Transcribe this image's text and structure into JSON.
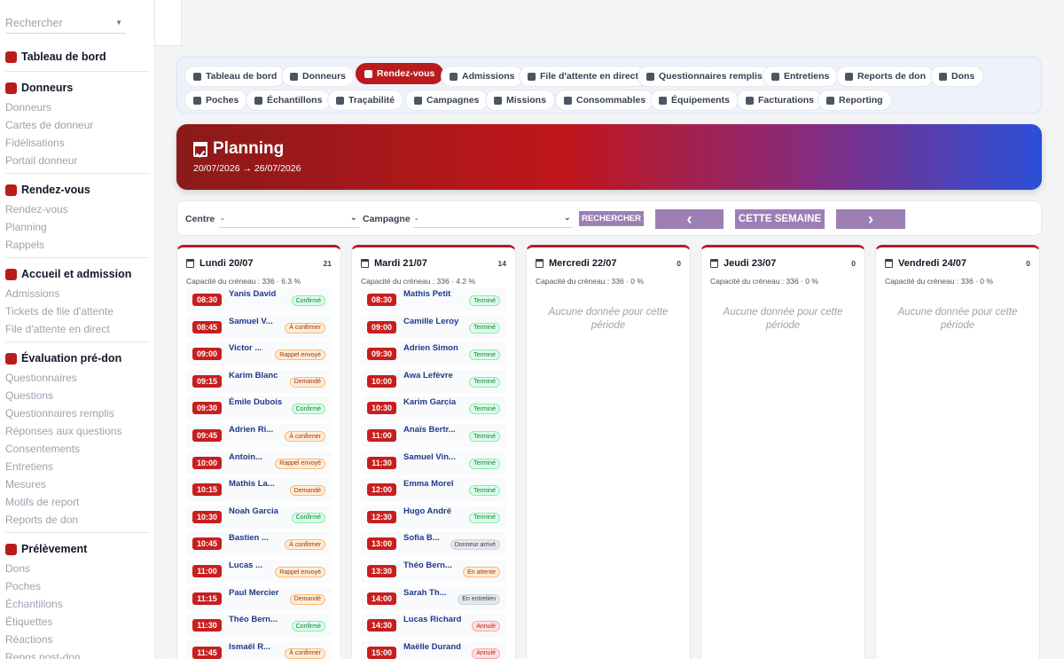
{
  "sidebar": {
    "search_placeholder": "Rechercher",
    "sections": [
      {
        "title": "Tableau de bord",
        "icon": "dashboard-icon",
        "items": []
      },
      {
        "title": "Donneurs",
        "icon": "user-plus-icon",
        "items": [
          "Donneurs",
          "Cartes de donneur",
          "Fidélisations",
          "Portail donneur"
        ]
      },
      {
        "title": "Rendez-vous",
        "icon": "calendar-icon",
        "items": [
          "Rendez-vous",
          "Planning",
          "Rappels"
        ]
      },
      {
        "title": "Accueil et admission",
        "icon": "clipboard-check-icon",
        "items": [
          "Admissions",
          "Tickets de file d'attente",
          "File d'attente en direct"
        ]
      },
      {
        "title": "Évaluation pré-don",
        "icon": "stethoscope-icon",
        "items": [
          "Questionnaires",
          "Questions",
          "Questionnaires remplis",
          "Réponses aux questions",
          "Consentements",
          "Entretiens",
          "Mesures",
          "Motifs de report",
          "Reports de don"
        ]
      },
      {
        "title": "Prélèvement",
        "icon": "blood-drop-icon",
        "items": [
          "Dons",
          "Poches",
          "Échantillons",
          "Étiquettes",
          "Réactions",
          "Repos post-don"
        ]
      }
    ]
  },
  "tabs": [
    {
      "label": "Tableau de bord",
      "icon": "dashboard-icon"
    },
    {
      "label": "Donneurs",
      "icon": "user-plus-icon"
    },
    {
      "label": "Rendez-vous",
      "icon": "calendar-icon",
      "active": true
    },
    {
      "label": "Admissions",
      "icon": "clipboard-icon"
    },
    {
      "label": "File d'attente en direct",
      "icon": "hourglass-icon"
    },
    {
      "label": "Questionnaires remplis",
      "icon": "list-check-icon"
    },
    {
      "label": "Entretiens",
      "icon": "stethoscope-icon"
    },
    {
      "label": "Reports de don",
      "icon": "calendar-x-icon"
    },
    {
      "label": "Dons",
      "icon": "blood-drop-icon"
    },
    {
      "label": "Poches",
      "icon": "bag-icon"
    },
    {
      "label": "Échantillons",
      "icon": "vial-icon"
    },
    {
      "label": "Traçabilité",
      "icon": "network-icon"
    },
    {
      "label": "Campagnes",
      "icon": "megaphone-icon"
    },
    {
      "label": "Missions",
      "icon": "route-icon"
    },
    {
      "label": "Consommables",
      "icon": "boxes-icon"
    },
    {
      "label": "Équipements",
      "icon": "desktop-icon"
    },
    {
      "label": "Facturations",
      "icon": "invoice-icon"
    },
    {
      "label": "Reporting",
      "icon": "chart-pie-icon"
    }
  ],
  "hero": {
    "title": "Planning",
    "range": "20/07/2026 → 26/07/2026",
    "icon": "calendar-check-icon"
  },
  "filters": {
    "centre_label": "Centre",
    "centre_value": "-",
    "campagne_label": "Campagne",
    "campagne_value": "-",
    "search_label": "RECHERCHER",
    "prev_label": "‹",
    "week_label": "CETTE SEMAINE",
    "next_label": "›"
  },
  "colors": {
    "accent": "#b91c1c",
    "button": "#9d7fb5",
    "name": "#1e3a8a"
  },
  "days": [
    {
      "title": "Lundi 20/07",
      "count": "21",
      "capacity": "Capacité du créneau : 336 · 6.3 %",
      "slots": [
        {
          "time": "08:30",
          "name": "Yanis David",
          "status": "Confirmé",
          "tone": "green"
        },
        {
          "time": "08:45",
          "name": "Samuel V...",
          "status": "À confirmer",
          "tone": "orange"
        },
        {
          "time": "09:00",
          "name": "Victor ...",
          "status": "Rappel envoyé",
          "tone": "orange"
        },
        {
          "time": "09:15",
          "name": "Karim Blanc",
          "status": "Demandé",
          "tone": "orange"
        },
        {
          "time": "09:30",
          "name": "Émile Dubois",
          "status": "Confirmé",
          "tone": "green"
        },
        {
          "time": "09:45",
          "name": "Adrien Ri...",
          "status": "À confirmer",
          "tone": "orange"
        },
        {
          "time": "10:00",
          "name": "Antoin...",
          "status": "Rappel envoyé",
          "tone": "orange"
        },
        {
          "time": "10:15",
          "name": "Mathis La...",
          "status": "Demandé",
          "tone": "orange"
        },
        {
          "time": "10:30",
          "name": "Noah Garcia",
          "status": "Confirmé",
          "tone": "green"
        },
        {
          "time": "10:45",
          "name": "Bastien ...",
          "status": "À confirmer",
          "tone": "orange"
        },
        {
          "time": "11:00",
          "name": "Lucas ...",
          "status": "Rappel envoyé",
          "tone": "orange"
        },
        {
          "time": "11:15",
          "name": "Paul Mercier",
          "status": "Demandé",
          "tone": "orange"
        },
        {
          "time": "11:30",
          "name": "Théo Bern...",
          "status": "Confirmé",
          "tone": "green"
        },
        {
          "time": "11:45",
          "name": "Ismaël R...",
          "status": "À confirmer",
          "tone": "orange"
        }
      ]
    },
    {
      "title": "Mardi 21/07",
      "count": "14",
      "capacity": "Capacité du créneau : 336 · 4.2 %",
      "slots": [
        {
          "time": "08:30",
          "name": "Mathis Petit",
          "status": "Terminé",
          "tone": "green"
        },
        {
          "time": "09:00",
          "name": "Camille Leroy",
          "status": "Terminé",
          "tone": "green"
        },
        {
          "time": "09:30",
          "name": "Adrien Simon",
          "status": "Terminé",
          "tone": "green"
        },
        {
          "time": "10:00",
          "name": "Awa Lefèvre",
          "status": "Terminé",
          "tone": "green"
        },
        {
          "time": "10:30",
          "name": "Karim Garcia",
          "status": "Terminé",
          "tone": "green"
        },
        {
          "time": "11:00",
          "name": "Anaïs Bertr...",
          "status": "Terminé",
          "tone": "green"
        },
        {
          "time": "11:30",
          "name": "Samuel Vin...",
          "status": "Terminé",
          "tone": "green"
        },
        {
          "time": "12:00",
          "name": "Emma Morel",
          "status": "Terminé",
          "tone": "green"
        },
        {
          "time": "12:30",
          "name": "Hugo André",
          "status": "Terminé",
          "tone": "green"
        },
        {
          "time": "13:00",
          "name": "Sofia B...",
          "status": "Donneur arrivé",
          "tone": "gray"
        },
        {
          "time": "13:30",
          "name": "Théo Bern...",
          "status": "En attente",
          "tone": "orange"
        },
        {
          "time": "14:00",
          "name": "Sarah Th...",
          "status": "En entretien",
          "tone": "gray"
        },
        {
          "time": "14:30",
          "name": "Lucas Richard",
          "status": "Annulé",
          "tone": "red"
        },
        {
          "time": "15:00",
          "name": "Maëlle Durand",
          "status": "Annulé",
          "tone": "red"
        }
      ]
    },
    {
      "title": "Mercredi 22/07",
      "count": "0",
      "capacity": "Capacité du créneau : 336 · 0 %",
      "empty": "Aucune donnée pour cette période",
      "slots": []
    },
    {
      "title": "Jeudi 23/07",
      "count": "0",
      "capacity": "Capacité du créneau : 336 · 0 %",
      "empty": "Aucune donnée pour cette période",
      "slots": []
    },
    {
      "title": "Vendredi 24/07",
      "count": "0",
      "capacity": "Capacité du créneau : 336 · 0 %",
      "empty": "Aucune donnée pour cette période",
      "slots": []
    }
  ]
}
